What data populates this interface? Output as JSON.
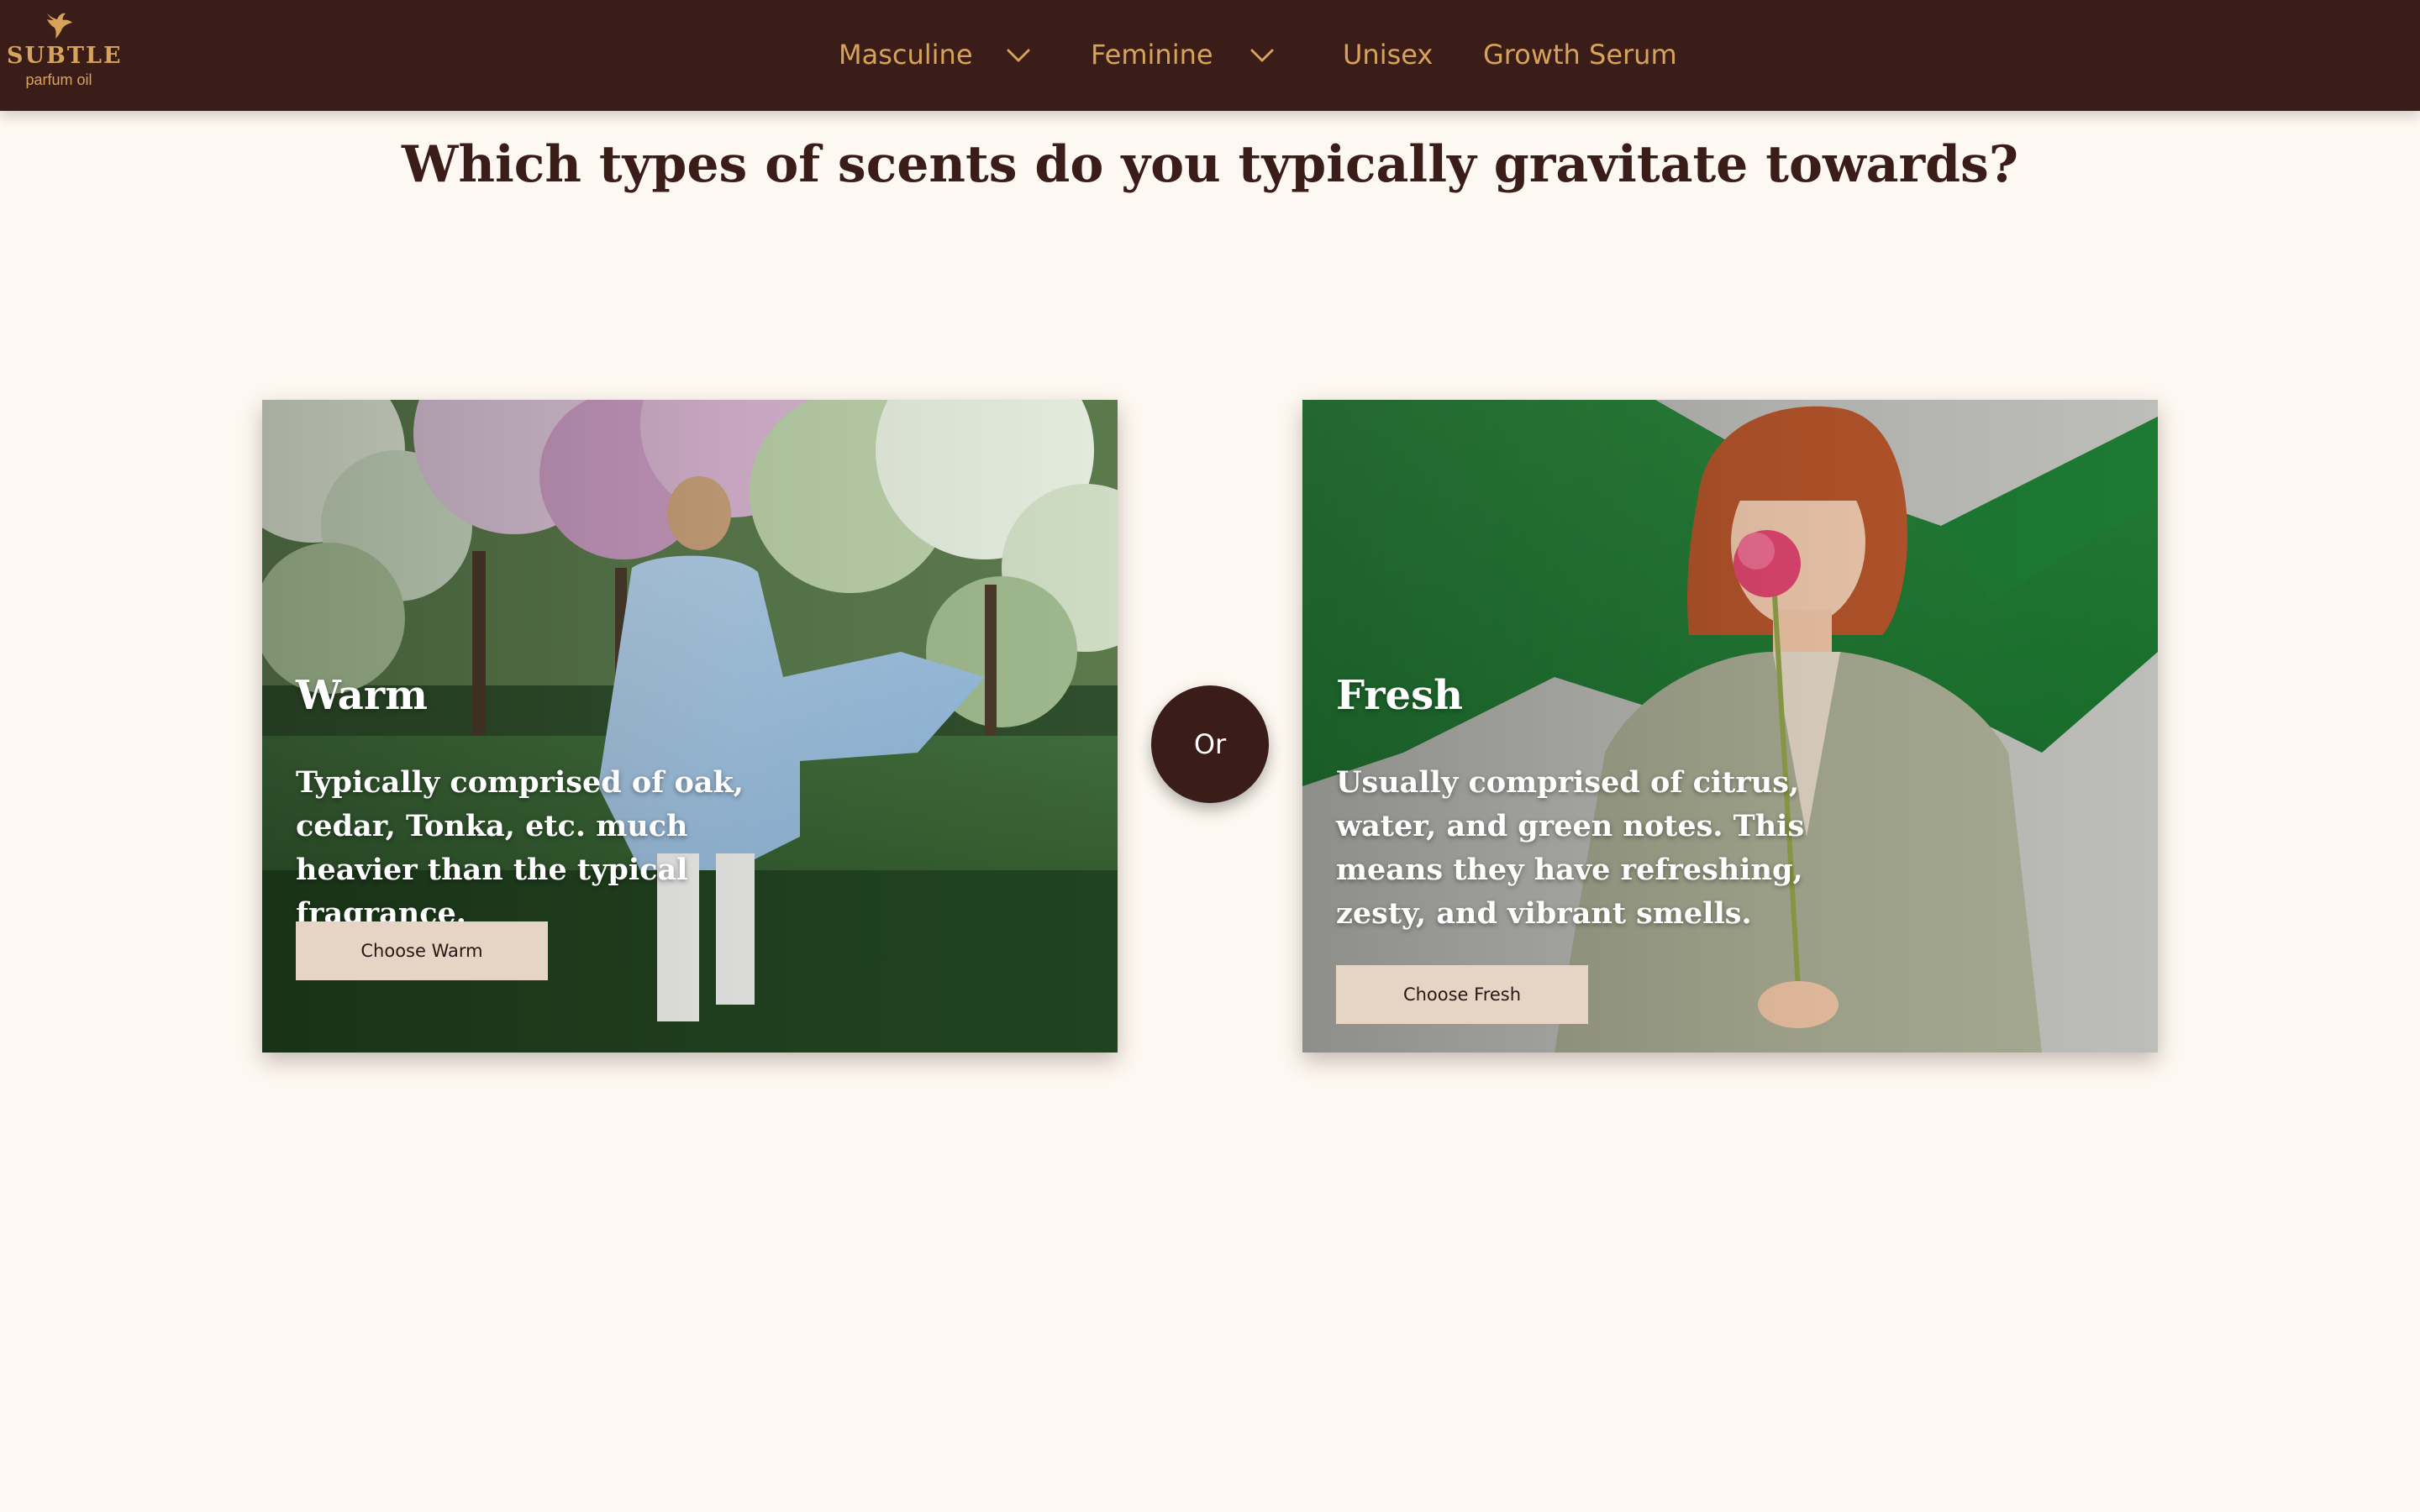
{
  "brand": {
    "name": "SUBTLE",
    "tagline": "parfum oil",
    "icon": "bird-icon",
    "color": "#d7a35b"
  },
  "nav": {
    "items": [
      {
        "label": "Masculine",
        "has_dropdown": true,
        "icon": "chevron-down-icon"
      },
      {
        "label": "Feminine",
        "has_dropdown": true,
        "icon": "chevron-down-icon"
      },
      {
        "label": "Unisex",
        "has_dropdown": false
      },
      {
        "label": "Growth Serum",
        "has_dropdown": false
      }
    ],
    "background": "#3a1d19"
  },
  "page": {
    "title": "Which types of scents do you typically gravitate towards?",
    "background": "#fdf8f1"
  },
  "options": [
    {
      "title": "Warm",
      "description": "Typically comprised of oak, cedar, Tonka, etc. much heavier than the typical fragrance.",
      "button_label": "Choose Warm"
    },
    {
      "title": "Fresh",
      "description": "Usually comprised of citrus, water, and green notes. This means they have refreshing, zesty, and vibrant smells.",
      "button_label": "Choose Fresh"
    }
  ],
  "divider": {
    "label": "Or"
  },
  "colors": {
    "accent": "#d7a35b",
    "dark": "#3a1d19",
    "button": "#e6d5c4"
  }
}
